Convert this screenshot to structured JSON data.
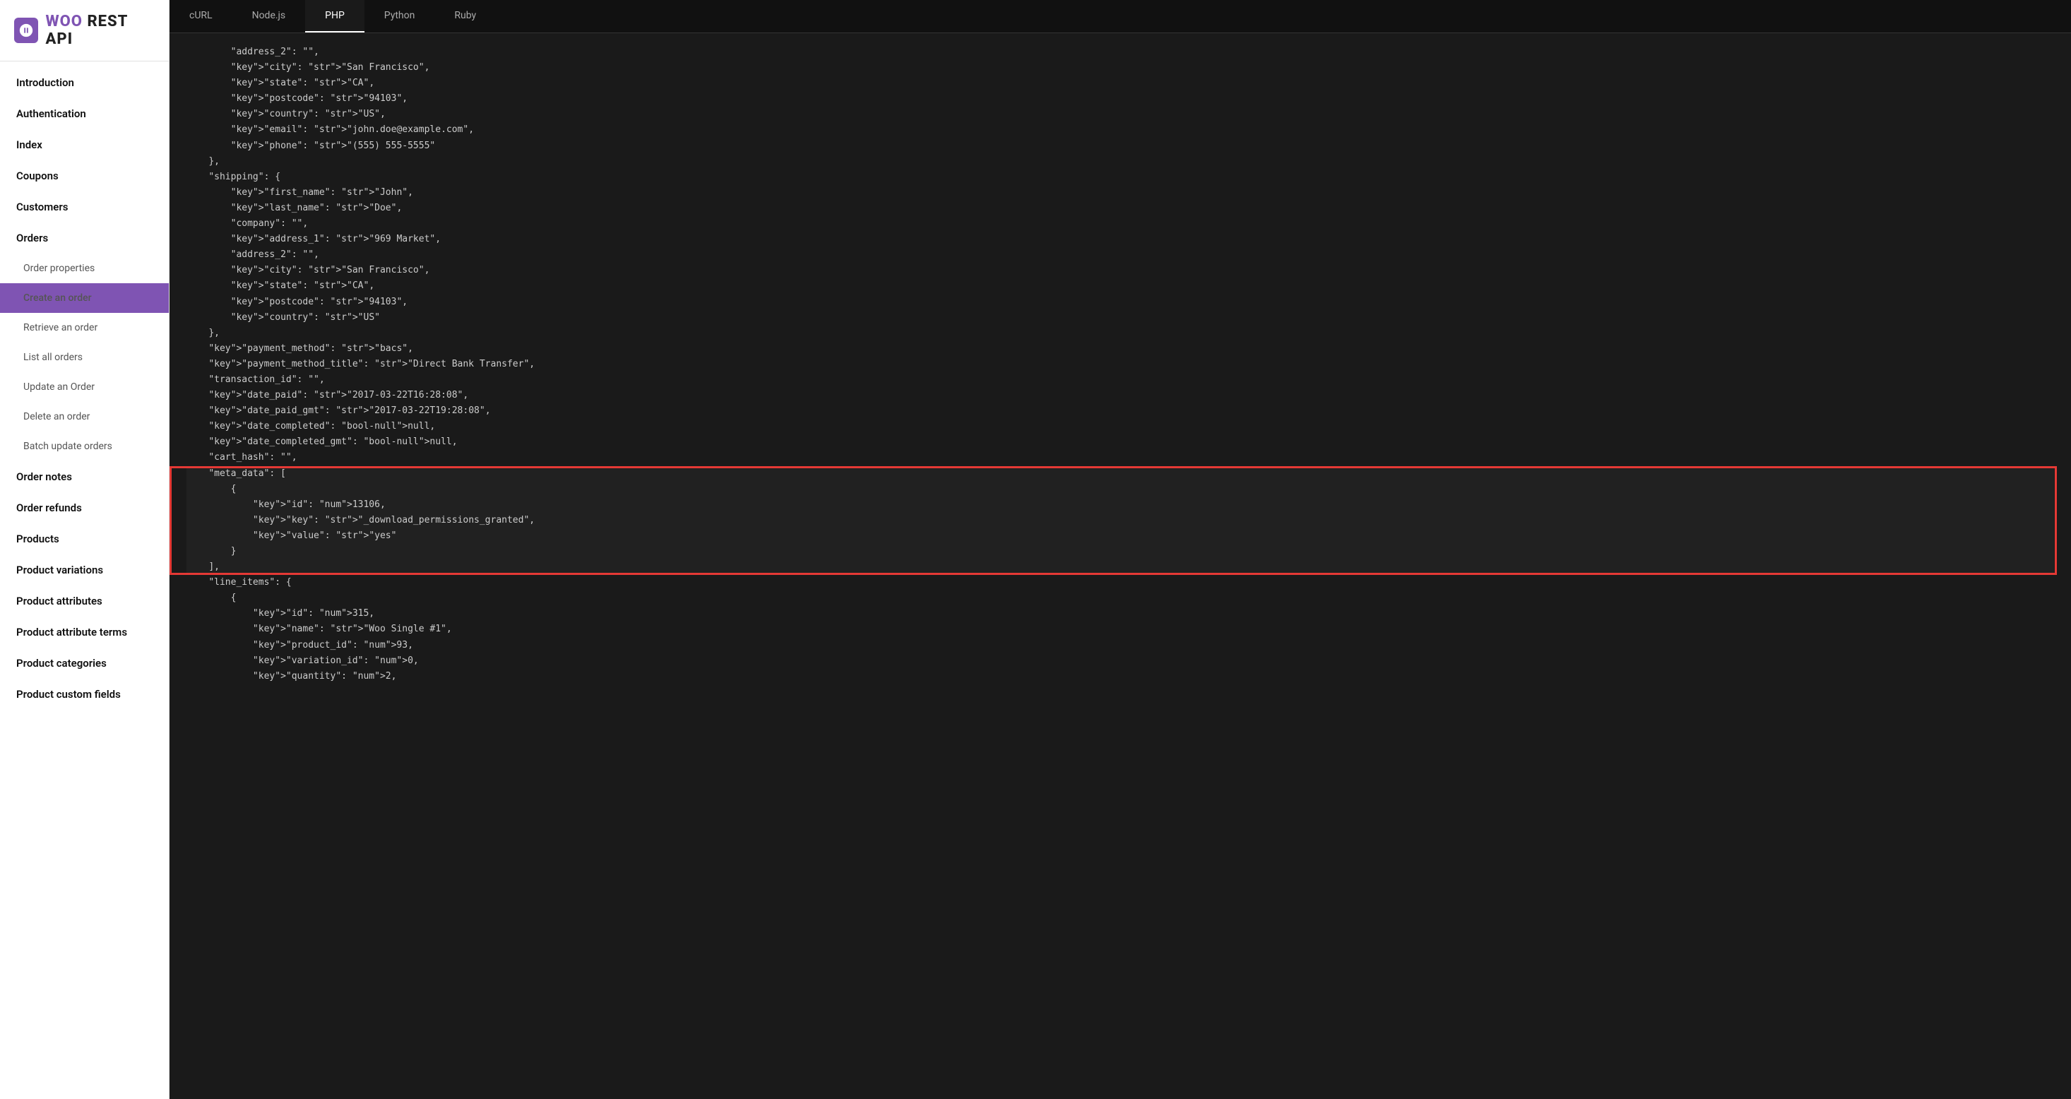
{
  "logo": {
    "icon_label": "woo-icon",
    "text_prefix": "WOO",
    "text_suffix": " REST API"
  },
  "sidebar": {
    "items": [
      {
        "id": "introduction",
        "label": "Introduction",
        "type": "parent",
        "active": false
      },
      {
        "id": "authentication",
        "label": "Authentication",
        "type": "parent",
        "active": false
      },
      {
        "id": "index",
        "label": "Index",
        "type": "parent",
        "active": false
      },
      {
        "id": "coupons",
        "label": "Coupons",
        "type": "parent",
        "active": false
      },
      {
        "id": "customers",
        "label": "Customers",
        "type": "parent",
        "active": false
      },
      {
        "id": "orders",
        "label": "Orders",
        "type": "parent",
        "active": false
      },
      {
        "id": "order-properties",
        "label": "Order properties",
        "type": "sub",
        "active": false
      },
      {
        "id": "create-an-order",
        "label": "Create an order",
        "type": "sub",
        "active": true
      },
      {
        "id": "retrieve-an-order",
        "label": "Retrieve an order",
        "type": "sub",
        "active": false
      },
      {
        "id": "list-all-orders",
        "label": "List all orders",
        "type": "sub",
        "active": false
      },
      {
        "id": "update-an-order",
        "label": "Update an Order",
        "type": "sub",
        "active": false
      },
      {
        "id": "delete-an-order",
        "label": "Delete an order",
        "type": "sub",
        "active": false
      },
      {
        "id": "batch-update-orders",
        "label": "Batch update orders",
        "type": "sub",
        "active": false
      },
      {
        "id": "order-notes",
        "label": "Order notes",
        "type": "parent",
        "active": false
      },
      {
        "id": "order-refunds",
        "label": "Order refunds",
        "type": "parent",
        "active": false
      },
      {
        "id": "products",
        "label": "Products",
        "type": "parent",
        "active": false
      },
      {
        "id": "product-variations",
        "label": "Product variations",
        "type": "parent",
        "active": false
      },
      {
        "id": "product-attributes",
        "label": "Product attributes",
        "type": "parent",
        "active": false
      },
      {
        "id": "product-attribute-terms",
        "label": "Product attribute terms",
        "type": "parent",
        "active": false
      },
      {
        "id": "product-categories",
        "label": "Product categories",
        "type": "parent",
        "active": false
      },
      {
        "id": "product-custom-fields",
        "label": "Product custom fields",
        "type": "parent",
        "active": false
      }
    ]
  },
  "code_tabs": [
    {
      "id": "curl",
      "label": "cURL",
      "active": false
    },
    {
      "id": "nodejs",
      "label": "Node.js",
      "active": false
    },
    {
      "id": "php",
      "label": "PHP",
      "active": true
    },
    {
      "id": "python",
      "label": "Python",
      "active": false
    },
    {
      "id": "ruby",
      "label": "Ruby",
      "active": false
    }
  ],
  "code_lines": [
    {
      "indent": 2,
      "content": "\"address_2\": \"\","
    },
    {
      "indent": 2,
      "content": "\"city\": \"San Francisco\","
    },
    {
      "indent": 2,
      "content": "\"state\": \"CA\","
    },
    {
      "indent": 2,
      "content": "\"postcode\": \"94103\","
    },
    {
      "indent": 2,
      "content": "\"country\": \"US\","
    },
    {
      "indent": 2,
      "content": "\"email\": \"john.doe@example.com\","
    },
    {
      "indent": 2,
      "content": "\"phone\": \"(555) 555-5555\""
    },
    {
      "indent": 1,
      "content": "},"
    },
    {
      "indent": 1,
      "content": "\"shipping\": {"
    },
    {
      "indent": 2,
      "content": "\"first_name\": \"John\","
    },
    {
      "indent": 2,
      "content": "\"last_name\": \"Doe\","
    },
    {
      "indent": 2,
      "content": "\"company\": \"\","
    },
    {
      "indent": 2,
      "content": "\"address_1\": \"969 Market\","
    },
    {
      "indent": 2,
      "content": "\"address_2\": \"\","
    },
    {
      "indent": 2,
      "content": "\"city\": \"San Francisco\","
    },
    {
      "indent": 2,
      "content": "\"state\": \"CA\","
    },
    {
      "indent": 2,
      "content": "\"postcode\": \"94103\","
    },
    {
      "indent": 2,
      "content": "\"country\": \"US\""
    },
    {
      "indent": 1,
      "content": "},"
    },
    {
      "indent": 1,
      "content": "\"payment_method\": \"bacs\","
    },
    {
      "indent": 1,
      "content": "\"payment_method_title\": \"Direct Bank Transfer\","
    },
    {
      "indent": 1,
      "content": "\"transaction_id\": \"\","
    },
    {
      "indent": 1,
      "content": "\"date_paid\": \"2017-03-22T16:28:08\","
    },
    {
      "indent": 1,
      "content": "\"date_paid_gmt\": \"2017-03-22T19:28:08\","
    },
    {
      "indent": 1,
      "content": "\"date_completed\": null,"
    },
    {
      "indent": 1,
      "content": "\"date_completed_gmt\": null,"
    },
    {
      "indent": 1,
      "content": "\"cart_hash\": \"\","
    },
    {
      "indent": 1,
      "content": "\"meta_data\": [",
      "highlight_start": true
    },
    {
      "indent": 2,
      "content": "{"
    },
    {
      "indent": 3,
      "content": "\"id\": 13106,"
    },
    {
      "indent": 3,
      "content": "\"key\": \"_download_permissions_granted\","
    },
    {
      "indent": 3,
      "content": "\"value\": \"yes\""
    },
    {
      "indent": 2,
      "content": "}"
    },
    {
      "indent": 1,
      "content": "],",
      "highlight_end": true
    },
    {
      "indent": 1,
      "content": "\"line_items\": {"
    },
    {
      "indent": 2,
      "content": "{"
    },
    {
      "indent": 3,
      "content": "\"id\": 315,"
    },
    {
      "indent": 3,
      "content": "\"name\": \"Woo Single #1\","
    },
    {
      "indent": 3,
      "content": "\"product_id\": 93,"
    },
    {
      "indent": 3,
      "content": "\"variation_id\": 0,"
    },
    {
      "indent": 3,
      "content": "\"quantity\": 2,"
    }
  ]
}
